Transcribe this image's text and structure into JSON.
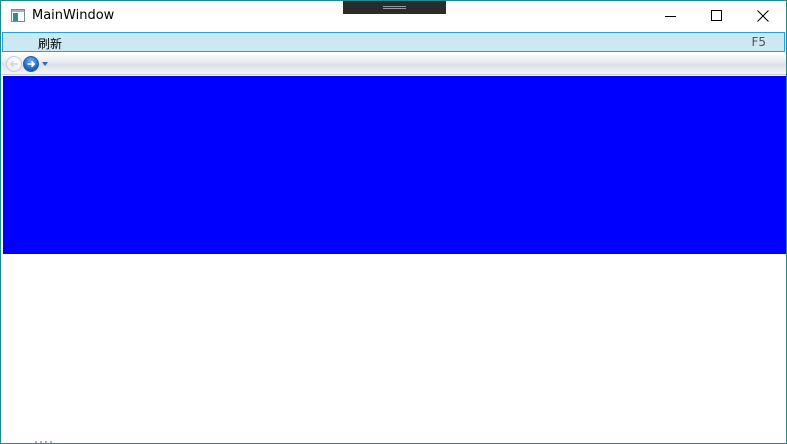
{
  "window": {
    "title": "MainWindow",
    "border_color": "#1f8a8f"
  },
  "titlebar": {
    "app_icon": "window-app-icon",
    "minimize_icon": "minimize-icon",
    "maximize_icon": "maximize-icon",
    "close_icon": "close-icon"
  },
  "menu": {
    "items": [
      {
        "label": "刷新",
        "shortcut": "F5"
      }
    ],
    "highlight_color": "#cce8f3",
    "highlight_border": "#26a0da"
  },
  "toolbar": {
    "back_icon": "back-arrow-icon",
    "forward_icon": "forward-arrow-icon",
    "history_icon": "history-dropdown-icon"
  },
  "content": {
    "panel_color": "#0000ff"
  }
}
